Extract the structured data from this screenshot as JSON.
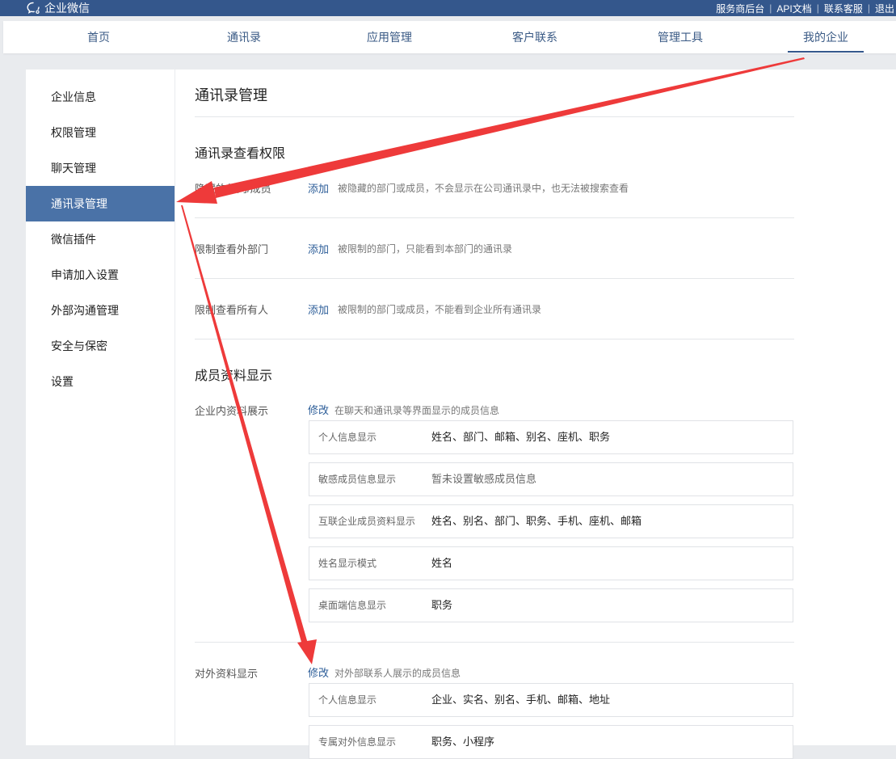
{
  "app": {
    "title": "企业微信",
    "top_links": [
      "服务商后台",
      "API文档",
      "联系客服",
      "退出"
    ]
  },
  "nav": {
    "tabs": [
      {
        "label": "首页"
      },
      {
        "label": "通讯录"
      },
      {
        "label": "应用管理"
      },
      {
        "label": "客户联系"
      },
      {
        "label": "管理工具"
      },
      {
        "label": "我的企业",
        "active": true
      }
    ]
  },
  "sidebar": {
    "items": [
      {
        "label": "企业信息"
      },
      {
        "label": "权限管理"
      },
      {
        "label": "聊天管理"
      },
      {
        "label": "通讯录管理",
        "active": true
      },
      {
        "label": "微信插件"
      },
      {
        "label": "申请加入设置"
      },
      {
        "label": "外部沟通管理"
      },
      {
        "label": "安全与保密"
      },
      {
        "label": "设置"
      }
    ]
  },
  "main": {
    "title": "通讯录管理",
    "view_permission": {
      "title": "通讯录查看权限",
      "rows": [
        {
          "label": "隐藏的部门/成员",
          "action": "添加",
          "desc": "被隐藏的部门或成员，不会显示在公司通讯录中，也无法被搜索查看"
        },
        {
          "label": "限制查看外部门",
          "action": "添加",
          "desc": "被限制的部门，只能看到本部门的通讯录"
        },
        {
          "label": "限制查看所有人",
          "action": "添加",
          "desc": "被限制的部门或成员，不能看到企业所有通讯录"
        }
      ]
    },
    "profile_display": {
      "title": "成员资料显示",
      "internal": {
        "label": "企业内资料展示",
        "action": "修改",
        "desc": "在聊天和通讯录等界面显示的成员信息",
        "boxes": [
          {
            "key": "个人信息显示",
            "value": "姓名、部门、邮箱、别名、座机、职务"
          },
          {
            "key": "敏感成员信息显示",
            "value": "暂未设置敏感成员信息"
          },
          {
            "key": "互联企业成员资料显示",
            "value": "姓名、别名、部门、职务、手机、座机、邮箱"
          },
          {
            "key": "姓名显示模式",
            "value": "姓名"
          },
          {
            "key": "桌面端信息显示",
            "value": "职务"
          }
        ]
      },
      "external": {
        "label": "对外资料显示",
        "action": "修改",
        "desc": "对外部联系人展示的成员信息",
        "boxes": [
          {
            "key": "个人信息显示",
            "value": "企业、实名、别名、手机、邮箱、地址"
          },
          {
            "key": "专属对外信息显示",
            "value": "职务、小程序"
          }
        ]
      }
    }
  },
  "colors": {
    "topbar": "#34578c",
    "active_sidebar": "#4a72a7",
    "link": "#2c5d98",
    "annotation_arrow": "#ee3a3a"
  }
}
